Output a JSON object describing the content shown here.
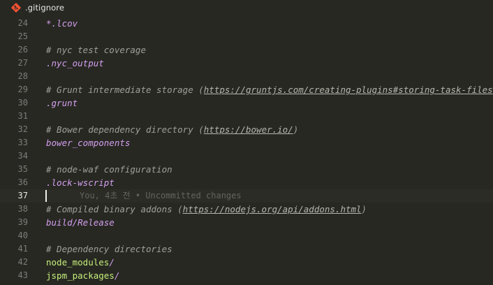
{
  "tab": {
    "title": ".gitignore",
    "icon": "git-icon",
    "icon_color": "#f05133"
  },
  "blame": {
    "text": "You, 4초 전 • Uncommitted changes"
  },
  "lines": [
    {
      "num": "24",
      "segments": [
        {
          "t": "*.lcov",
          "k": "pattern"
        }
      ]
    },
    {
      "num": "25",
      "segments": []
    },
    {
      "num": "26",
      "segments": [
        {
          "t": "# nyc test coverage",
          "k": "comment"
        }
      ]
    },
    {
      "num": "27",
      "segments": [
        {
          "t": ".nyc_output",
          "k": "pattern"
        }
      ]
    },
    {
      "num": "28",
      "segments": []
    },
    {
      "num": "29",
      "segments": [
        {
          "t": "# Grunt intermediate storage (",
          "k": "comment"
        },
        {
          "t": "https://gruntjs.com/creating-plugins#storing-task-files",
          "k": "link"
        },
        {
          "t": ")",
          "k": "comment"
        }
      ]
    },
    {
      "num": "30",
      "segments": [
        {
          "t": ".grunt",
          "k": "pattern"
        }
      ]
    },
    {
      "num": "31",
      "segments": []
    },
    {
      "num": "32",
      "segments": [
        {
          "t": "# Bower dependency directory (",
          "k": "comment"
        },
        {
          "t": "https://bower.io/",
          "k": "link"
        },
        {
          "t": ")",
          "k": "comment"
        }
      ]
    },
    {
      "num": "33",
      "segments": [
        {
          "t": "bower_components",
          "k": "pattern"
        }
      ]
    },
    {
      "num": "34",
      "segments": []
    },
    {
      "num": "35",
      "segments": [
        {
          "t": "# node-waf configuration",
          "k": "comment"
        }
      ]
    },
    {
      "num": "36",
      "segments": [
        {
          "t": ".lock-wscript",
          "k": "pattern"
        }
      ]
    },
    {
      "num": "37",
      "segments": [],
      "active": true
    },
    {
      "num": "38",
      "segments": [
        {
          "t": "# Compiled binary addons (",
          "k": "comment"
        },
        {
          "t": "https://nodejs.org/api/addons.html",
          "k": "link"
        },
        {
          "t": ")",
          "k": "comment"
        }
      ]
    },
    {
      "num": "39",
      "segments": [
        {
          "t": "build/Release",
          "k": "pattern"
        }
      ]
    },
    {
      "num": "40",
      "segments": []
    },
    {
      "num": "41",
      "segments": [
        {
          "t": "# Dependency directories",
          "k": "comment"
        }
      ]
    },
    {
      "num": "42",
      "segments": [
        {
          "t": "node_modules",
          "k": "path"
        },
        {
          "t": "/",
          "k": "slash"
        }
      ]
    },
    {
      "num": "43",
      "segments": [
        {
          "t": "jspm_packages",
          "k": "path"
        },
        {
          "t": "/",
          "k": "slash"
        }
      ]
    }
  ]
}
